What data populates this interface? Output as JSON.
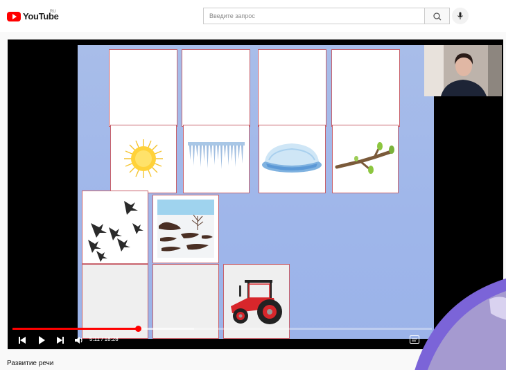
{
  "header": {
    "logo_text": "YouTube",
    "logo_region": "RU",
    "search_placeholder": "Введите запрос"
  },
  "player": {
    "time": "5:11 / 18:28",
    "progress": 0.3
  },
  "video_title": "Развитие речи",
  "colors": {
    "brand": "#ff0000",
    "slide_bg": "#a0b7ea",
    "card_border": "#c8606a"
  }
}
